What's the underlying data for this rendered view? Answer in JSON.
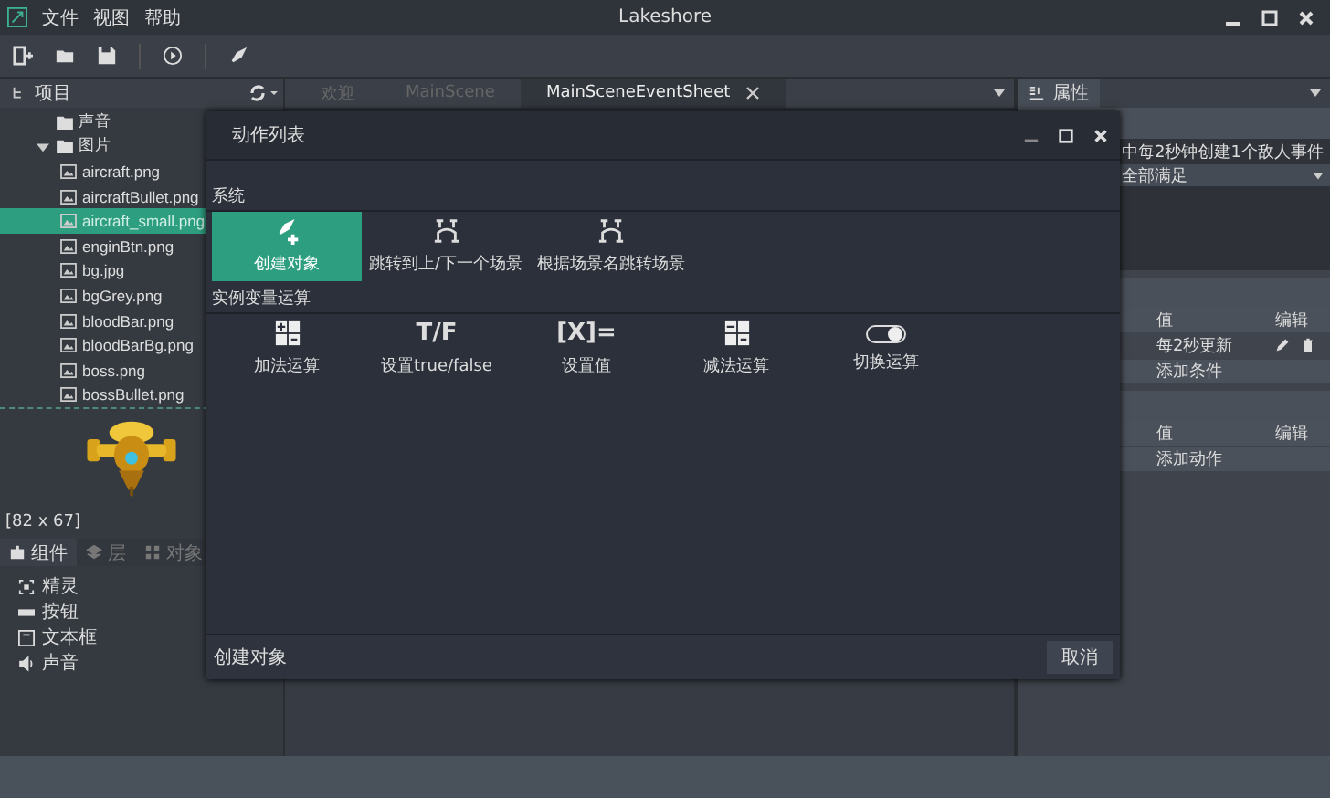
{
  "window": {
    "title": "Lakeshore",
    "menu": [
      "文件",
      "视图",
      "帮助"
    ]
  },
  "project_panel": {
    "title": "项目",
    "tree": [
      {
        "label": "声音",
        "kind": "folder",
        "selected": false
      },
      {
        "label": "图片",
        "kind": "folder",
        "selected": false,
        "expanded": true,
        "children": [
          {
            "label": "aircraft.png",
            "kind": "file",
            "selected": false
          },
          {
            "label": "aircraftBullet.png",
            "kind": "file",
            "selected": false
          },
          {
            "label": "aircraft_small.png",
            "kind": "file",
            "selected": true
          },
          {
            "label": "enginBtn.png",
            "kind": "file",
            "selected": false
          },
          {
            "label": "bg.jpg",
            "kind": "file",
            "selected": false
          },
          {
            "label": "bgGrey.png",
            "kind": "file",
            "selected": false
          },
          {
            "label": "bloodBar.png",
            "kind": "file",
            "selected": false
          },
          {
            "label": "bloodBarBg.png",
            "kind": "file",
            "selected": false
          },
          {
            "label": "boss.png",
            "kind": "file",
            "selected": false
          },
          {
            "label": "bossBullet.png",
            "kind": "file",
            "selected": false
          }
        ]
      }
    ]
  },
  "preview": {
    "size": "[82 x 67]"
  },
  "components_panel": {
    "tabs": [
      {
        "label": "组件",
        "kind": "puzzle",
        "selected": true
      },
      {
        "label": "层",
        "kind": "layers",
        "selected": false
      },
      {
        "label": "对象",
        "kind": "grid",
        "selected": false
      }
    ],
    "items": [
      {
        "label": "精灵",
        "kind": "sprite"
      },
      {
        "label": "按钮",
        "kind": "button"
      },
      {
        "label": "文本框",
        "kind": "textbox"
      },
      {
        "label": "声音",
        "kind": "sound"
      }
    ]
  },
  "editor_tabs": [
    {
      "label": "欢迎",
      "selected": false
    },
    {
      "label": "MainScene",
      "selected": false
    },
    {
      "label": "MainSceneEventSheet",
      "selected": true
    }
  ],
  "properties": {
    "title": "属性",
    "event_name": "中每2秒钟创建1个敌人事件",
    "condition_mode": "全部满足",
    "conditions": {
      "columns": [
        "值",
        "编辑"
      ],
      "rows": [
        {
          "value": "每2秒更新"
        }
      ],
      "add": "添加条件"
    },
    "actions": {
      "columns": [
        "值",
        "编辑"
      ],
      "add": "添加动作"
    }
  },
  "dialog": {
    "title": "动作列表",
    "groups": [
      {
        "name": "系统",
        "actions": [
          {
            "label": "创建对象",
            "kind": "create",
            "selected": true
          },
          {
            "label": "跳转到上/下一个场景",
            "kind": "scene",
            "selected": false
          },
          {
            "label": "根据场景名跳转场景",
            "kind": "scene",
            "selected": false
          }
        ]
      },
      {
        "name": "实例变量运算",
        "actions": [
          {
            "label": "加法运算",
            "kind": "add",
            "selected": false
          },
          {
            "label": "设置true/false",
            "kind": "text",
            "glyph": "T/F",
            "selected": false
          },
          {
            "label": "设置值",
            "kind": "text",
            "glyph": "[X]=",
            "selected": false
          },
          {
            "label": "减法运算",
            "kind": "subtract",
            "selected": false
          },
          {
            "label": "切换运算",
            "kind": "toggle",
            "selected": false
          }
        ]
      }
    ],
    "status": "创建对象",
    "cancel": "取消"
  }
}
